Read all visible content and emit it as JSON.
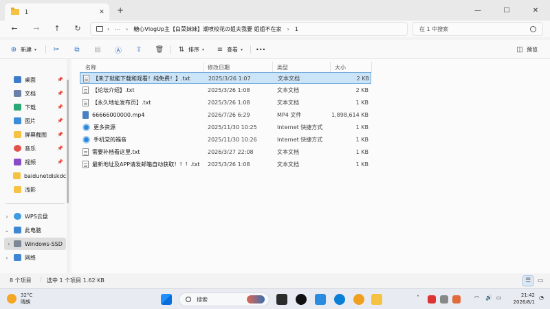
{
  "tab": {
    "title": "1",
    "close": "✕",
    "new": "+"
  },
  "window_controls": {
    "minimize": "—",
    "maximize": "☐",
    "close": "✕"
  },
  "nav": {
    "back": "←",
    "forward": "→",
    "up": "↑",
    "refresh": "↻"
  },
  "address": {
    "more": "⋯",
    "path": [
      "糖心VlogUp主【白菜妹妹】潮喷校花の姐夫我要 姐姐不在家",
      "1"
    ]
  },
  "search": {
    "placeholder": "在 1 中搜索"
  },
  "toolbar": {
    "new_label": "新建",
    "sort_label": "排序",
    "view_label": "查看",
    "more": "•••",
    "details_label": "预览"
  },
  "sidebar": {
    "quick_access": [
      {
        "label": "桌面",
        "icon": "desktop-icon",
        "color": "#3d7cc9"
      },
      {
        "label": "文档",
        "icon": "documents-icon",
        "color": "#6b7fa8"
      },
      {
        "label": "下载",
        "icon": "downloads-icon",
        "color": "#2aa876"
      },
      {
        "label": "图片",
        "icon": "pictures-icon",
        "color": "#3c8dd8"
      },
      {
        "label": "屏幕截图",
        "icon": "folder-icon",
        "color": "#f5c242"
      },
      {
        "label": "音乐",
        "icon": "music-icon",
        "color": "#e0554a"
      },
      {
        "label": "视频",
        "icon": "videos-icon",
        "color": "#8b4bc7"
      },
      {
        "label": "baidunetdiskdc",
        "icon": "folder-icon",
        "color": "#f5c242"
      },
      {
        "label": "浅影",
        "icon": "folder-icon",
        "color": "#f5c242"
      }
    ],
    "wps": "WPS云盘",
    "this_pc": "此电脑",
    "drive": "Windows-SSD",
    "network": "网络"
  },
  "columns": {
    "name": "名称",
    "date": "修改日期",
    "type": "类型",
    "size": "大小"
  },
  "files": [
    {
      "name": "【未了就能下载和观看！纯免费！】.txt",
      "date": "2025/3/26 1:07",
      "type": "文本文档",
      "size": "2 KB",
      "kind": "txt"
    },
    {
      "name": "【论坛介绍】.txt",
      "date": "2025/3/26 1:08",
      "type": "文本文档",
      "size": "2 KB",
      "kind": "txt"
    },
    {
      "name": "【永久地址发布页】.txt",
      "date": "2025/3/26 1:08",
      "type": "文本文档",
      "size": "1 KB",
      "kind": "txt"
    },
    {
      "name": "66666000000.mp4",
      "date": "2026/7/26 6:29",
      "type": "MP4 文件",
      "size": "1,898,614 KB",
      "kind": "mp4"
    },
    {
      "name": "更多资源",
      "date": "2025/11/30 10:25",
      "type": "Internet 快捷方式",
      "size": "1 KB",
      "kind": "link"
    },
    {
      "name": "手机党的福音",
      "date": "2025/11/30 10:26",
      "type": "Internet 快捷方式",
      "size": "1 KB",
      "kind": "link"
    },
    {
      "name": "需要补档看这里.txt",
      "date": "2026/3/27 22:08",
      "type": "文本文档",
      "size": "1 KB",
      "kind": "txt"
    },
    {
      "name": "最新地址及APP请发邮箱自动获取！！！.txt",
      "date": "2025/3/26 1:08",
      "type": "文本文档",
      "size": "1 KB",
      "kind": "txt"
    }
  ],
  "status": {
    "count": "8 个项目",
    "selected": "选中 1 个项目  1.62 KB"
  },
  "taskbar": {
    "temp": "32°C",
    "weather": "晴朗",
    "search_label": "搜索",
    "time": "21:42",
    "date": "2026/8/1"
  }
}
